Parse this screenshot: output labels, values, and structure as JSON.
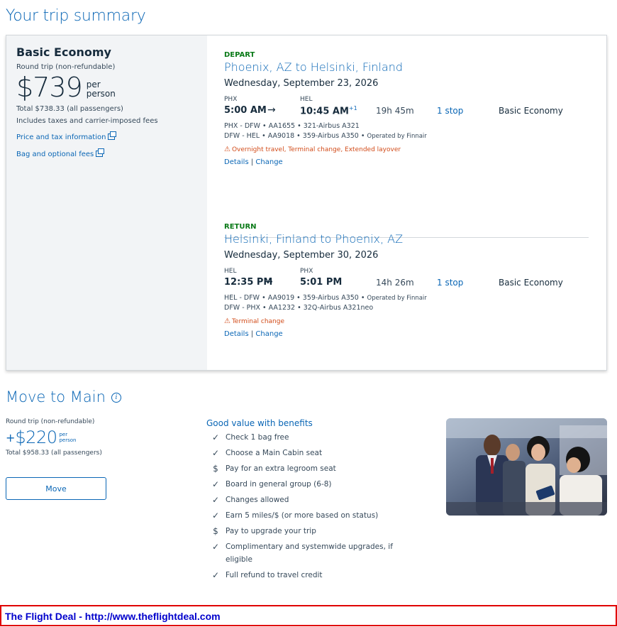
{
  "page_title": "Your trip summary",
  "fare": {
    "name": "Basic Economy",
    "trip_type": "Round trip (non-refundable)",
    "price": "$739",
    "per": "per",
    "person": "person",
    "total": "Total $738.33 (all passengers)",
    "includes": "Includes taxes and carrier-imposed fees",
    "price_tax_link": "Price and tax information",
    "bag_link": "Bag and optional fees"
  },
  "depart": {
    "tag": "DEPART",
    "route": "Phoenix, AZ to Helsinki, Finland",
    "date": "Wednesday, September 23, 2026",
    "from_code": "PHX",
    "to_code": "HEL",
    "depart_time": "5:00 AM",
    "arrow": "→",
    "arrive_time": "10:45 AM",
    "day_offset": "+1",
    "duration": "19h 45m",
    "stops": "1 stop",
    "cabin": "Basic Economy",
    "legs": [
      {
        "text": "PHX - DFW • AA1655 • 321-Airbus A321",
        "operated": ""
      },
      {
        "text": "DFW - HEL • AA9018 • 359-Airbus A350 • ",
        "operated": "Operated by Finnair"
      }
    ],
    "warning": "Overnight travel, Terminal change, Extended layover",
    "details_link": "Details",
    "separator": "|",
    "change_link": "Change"
  },
  "return": {
    "tag": "RETURN",
    "route": "Helsinki, Finland to Phoenix, AZ",
    "date": "Wednesday, September 30, 2026",
    "from_code": "HEL",
    "to_code": "PHX",
    "depart_time": "12:35 PM",
    "arrow": "→",
    "arrive_time": "5:01 PM",
    "duration": "14h 26m",
    "stops": "1 stop",
    "cabin": "Basic Economy",
    "legs": [
      {
        "text": "HEL - DFW • AA9019 • 359-Airbus A350 • ",
        "operated": "Operated by Finnair"
      },
      {
        "text": "DFW - PHX • AA1232 • 32Q-Airbus A321neo",
        "operated": ""
      }
    ],
    "warning": "Terminal change",
    "details_link": "Details",
    "separator": "|",
    "change_link": "Change"
  },
  "move": {
    "title": "Move to Main",
    "info_icon": "i",
    "trip_type": "Round trip (non-refundable)",
    "plus": "+",
    "price": "$220",
    "per": "per",
    "person": "person",
    "total": "Total $958.33 (all passengers)",
    "button": "Move",
    "benefits_title": "Good value with benefits",
    "benefits": [
      {
        "icon": "check-icon",
        "glyph": "✓",
        "text": "Check 1 bag free"
      },
      {
        "icon": "check-icon",
        "glyph": "✓",
        "text": "Choose a Main Cabin seat"
      },
      {
        "icon": "dollar-icon",
        "glyph": "$",
        "text": "Pay for an extra legroom seat"
      },
      {
        "icon": "check-icon",
        "glyph": "✓",
        "text": "Board in general group (6-8)"
      },
      {
        "icon": "check-icon",
        "glyph": "✓",
        "text": "Changes allowed"
      },
      {
        "icon": "check-icon",
        "glyph": "✓",
        "text": "Earn 5 miles/$ (or more based on status)"
      },
      {
        "icon": "dollar-icon",
        "glyph": "$",
        "text": "Pay to upgrade your trip"
      },
      {
        "icon": "check-icon",
        "glyph": "✓",
        "text": "Complimentary and systemwide upgrades, if eligible"
      },
      {
        "icon": "check-icon",
        "glyph": "✓",
        "text": "Full refund to travel credit"
      }
    ]
  },
  "footer": {
    "text": "The Flight Deal - http://www.theflightdeal.com"
  },
  "colors": {
    "brand_blue": "#0a66b5",
    "depart_green": "#0a7a18",
    "warning_orange": "#d24c1a",
    "footer_border": "#e00000"
  }
}
